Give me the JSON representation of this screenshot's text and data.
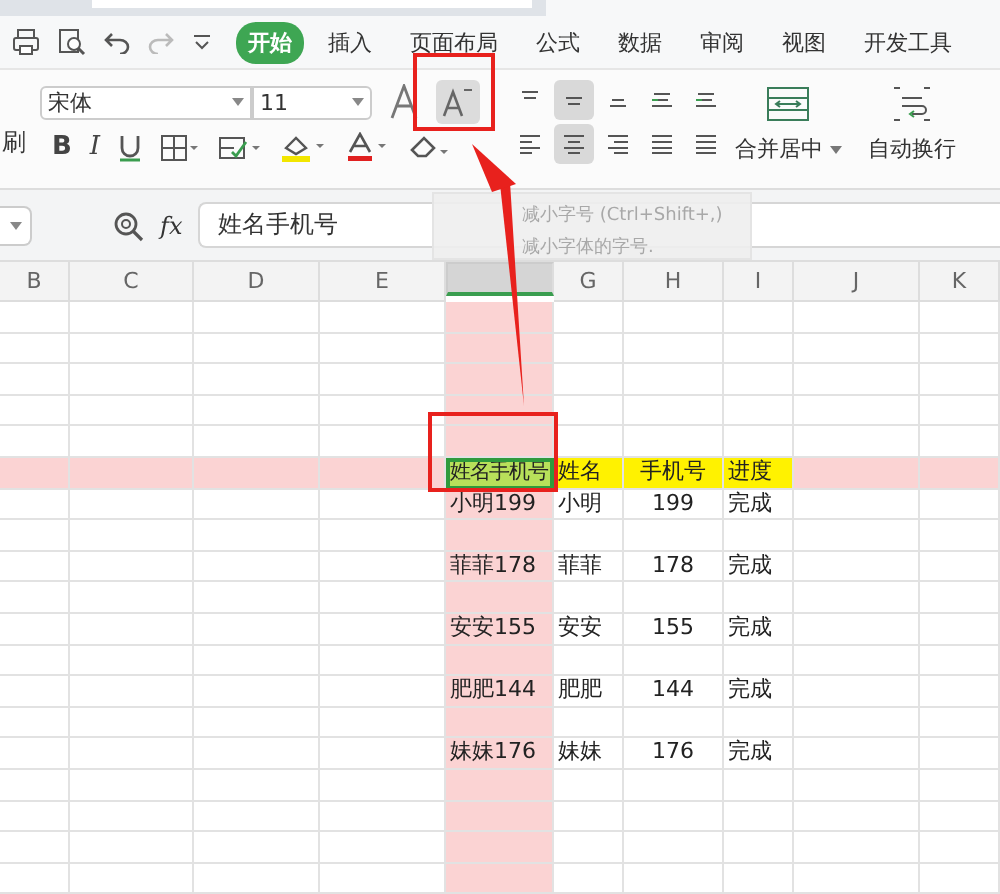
{
  "menu_tabs": [
    {
      "label": "开始",
      "selected": true
    },
    {
      "label": "插入",
      "selected": false
    },
    {
      "label": "页面布局",
      "selected": false
    },
    {
      "label": "公式",
      "selected": false
    },
    {
      "label": "数据",
      "selected": false
    },
    {
      "label": "审阅",
      "selected": false
    },
    {
      "label": "视图",
      "selected": false
    },
    {
      "label": "开发工具",
      "selected": false
    }
  ],
  "ribbon": {
    "cut_label": "刷",
    "bold_label": "B",
    "italic_label": "I",
    "font_name": "宋体",
    "font_size": "11",
    "merge_button": "合并居中",
    "wrap_button": "自动换行"
  },
  "formula_bar": {
    "fx_label": "fx",
    "value": "姓名手机号"
  },
  "tooltip": {
    "title": "减小字号 (Ctrl+Shift+,)",
    "description": "减小字体的字号."
  },
  "sheet": {
    "columns": [
      {
        "label": "B",
        "selected": false
      },
      {
        "label": "C",
        "selected": false
      },
      {
        "label": "D",
        "selected": false
      },
      {
        "label": "E",
        "selected": false
      },
      {
        "selected": true
      },
      {
        "label": "G",
        "selected": false
      },
      {
        "label": "H",
        "selected": false
      },
      {
        "label": "I",
        "selected": false
      },
      {
        "label": "J",
        "selected": false
      },
      {
        "label": "K",
        "selected": false
      }
    ],
    "rows": [
      {
        "selected": false
      },
      {
        "selected": false
      },
      {
        "selected": false
      },
      {
        "selected": false
      },
      {
        "selected": false
      },
      {
        "selected": true,
        "cells": [
          null,
          null,
          null,
          null,
          {
            "text": "姓名手机号",
            "selected": true,
            "highlighted": true
          },
          {
            "text": "姓名",
            "selected": false,
            "highlighted": true
          },
          {
            "text": "手机号",
            "selected": false,
            "highlighted": true
          },
          {
            "text": "进度",
            "selected": false,
            "highlighted": true
          },
          null,
          null
        ]
      },
      {
        "selected": false,
        "cells": [
          null,
          null,
          null,
          null,
          {
            "text": "小明199",
            "selected": false,
            "highlighted": false
          },
          {
            "text": "小明",
            "selected": false,
            "highlighted": false
          },
          {
            "text": "199",
            "selected": false,
            "highlighted": false
          },
          {
            "text": "完成",
            "selected": false,
            "highlighted": false
          },
          null,
          null
        ]
      },
      {
        "selected": false
      },
      {
        "selected": false,
        "cells": [
          null,
          null,
          null,
          null,
          {
            "text": "菲菲178",
            "selected": false,
            "highlighted": false
          },
          {
            "text": "菲菲",
            "selected": false,
            "highlighted": false
          },
          {
            "text": "178",
            "selected": false,
            "highlighted": false
          },
          {
            "text": "完成",
            "selected": false,
            "highlighted": false
          },
          null,
          null
        ]
      },
      {
        "selected": false
      },
      {
        "selected": false,
        "cells": [
          null,
          null,
          null,
          null,
          {
            "text": "安安155",
            "selected": false,
            "highlighted": false
          },
          {
            "text": "安安",
            "selected": false,
            "highlighted": false
          },
          {
            "text": "155",
            "selected": false,
            "highlighted": false
          },
          {
            "text": "完成",
            "selected": false,
            "highlighted": false
          },
          null,
          null
        ]
      },
      {
        "selected": false
      },
      {
        "selected": false,
        "cells": [
          null,
          null,
          null,
          null,
          {
            "text": "肥肥144",
            "selected": false,
            "highlighted": false
          },
          {
            "text": "肥肥",
            "selected": false,
            "highlighted": false
          },
          {
            "text": "144",
            "selected": false,
            "highlighted": false
          },
          {
            "text": "完成",
            "selected": false,
            "highlighted": false
          },
          null,
          null
        ]
      },
      {
        "selected": false
      },
      {
        "selected": false,
        "cells": [
          null,
          null,
          null,
          null,
          {
            "text": "妹妹176",
            "selected": false,
            "highlighted": false
          },
          {
            "text": "妹妹",
            "selected": false,
            "highlighted": false
          },
          {
            "text": "176",
            "selected": false,
            "highlighted": false
          },
          {
            "text": "完成",
            "selected": false,
            "highlighted": false
          },
          null,
          null
        ]
      },
      {
        "selected": false
      },
      {
        "selected": false
      },
      {
        "selected": false
      },
      {
        "selected": false
      }
    ]
  }
}
